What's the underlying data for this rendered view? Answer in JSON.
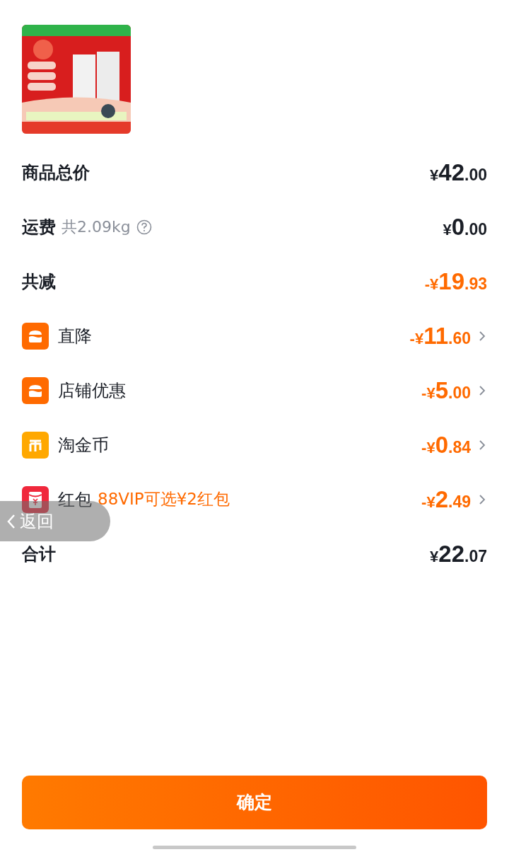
{
  "rows": [
    {
      "kind": "plain",
      "label": "商品总价",
      "amount": {
        "prefix": "¥",
        "integer": "42",
        "decimal": ".00"
      },
      "highlight": false
    },
    {
      "kind": "plain",
      "label": "运费",
      "note": "共2.09kg",
      "help": true,
      "amount": {
        "prefix": "¥",
        "integer": "0",
        "decimal": ".00"
      },
      "highlight": false
    },
    {
      "kind": "plain",
      "label": "共减",
      "amount": {
        "prefix": "-¥",
        "integer": "19",
        "decimal": ".93"
      },
      "highlight": true
    },
    {
      "kind": "store",
      "label": "直降",
      "amount": {
        "prefix": "-¥",
        "integer": "11",
        "decimal": ".60"
      },
      "highlight": true
    },
    {
      "kind": "store",
      "label": "店铺优惠",
      "amount": {
        "prefix": "-¥",
        "integer": "5",
        "decimal": ".00"
      },
      "highlight": true
    },
    {
      "kind": "coin",
      "label": "淘金币",
      "amount": {
        "prefix": "-¥",
        "integer": "0",
        "decimal": ".84"
      },
      "highlight": true
    },
    {
      "kind": "packet",
      "label": "红包",
      "promo": "88VIP可选¥2红包",
      "amount": {
        "prefix": "-¥",
        "integer": "2",
        "decimal": ".49"
      },
      "highlight": true
    },
    {
      "kind": "plain",
      "label": "合计",
      "amount": {
        "prefix": "¥",
        "integer": "22",
        "decimal": ".07"
      },
      "highlight": false
    }
  ],
  "back_button": {
    "label": "返回"
  },
  "confirm_button": {
    "label": "确定"
  }
}
